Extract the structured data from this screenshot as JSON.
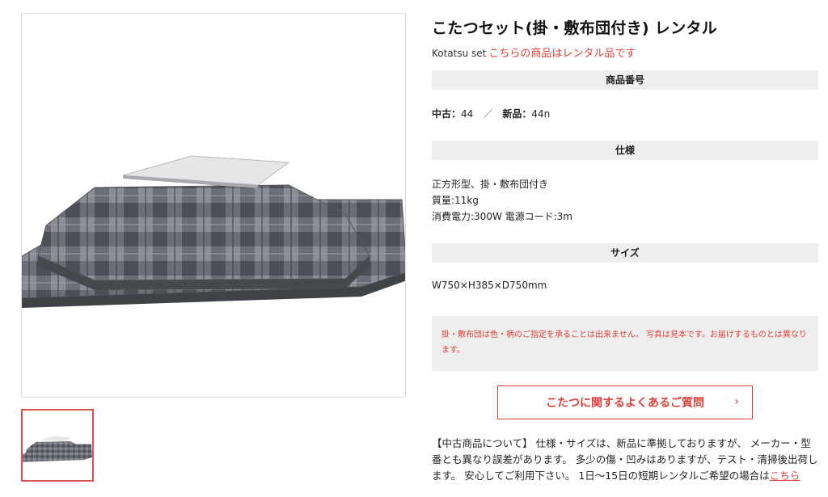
{
  "product": {
    "title": "こたつセット(掛・敷布団付き) レンタル",
    "subtitle_en": "Kotatsu set",
    "subtitle_note": "こちらの商品はレンタル品です"
  },
  "sections": {
    "code_header": "商品番号",
    "spec_header": "仕様",
    "size_header": "サイズ"
  },
  "codes": {
    "used_label": "中古：",
    "used_value": "44",
    "separator": "／",
    "new_label": "新品：",
    "new_value": "44n"
  },
  "spec": {
    "line1": "正方形型、掛・敷布団付き",
    "line2": "質量:11kg",
    "line3": "消費電力:300W 電源コード:3m"
  },
  "size": {
    "value": "W750×H385×D750mm"
  },
  "notice": {
    "text": "掛・敷布団は色・柄のご指定を承ることは出来ません。 写真は見本です。お届けするものとは異なります。"
  },
  "faq_button": {
    "label": "こたつに関するよくあるご質問",
    "chevron": "›"
  },
  "usage": {
    "text": "【中古商品について】 仕様・サイズは、新品に準拠しておりますが、 メーカー・型番とも異なり誤差があります。 多少の傷・凹みはありますが、テスト・清掃後出荷します。 安心してご利用下さい。 1日〜15日の短期レンタルご希望の場合は",
    "link": "こちら"
  },
  "images": {
    "main_icon": "kotatsu-photo",
    "thumb_icon": "kotatsu-thumbnail"
  },
  "colors": {
    "accent": "#e0413b",
    "section_bg": "#eeeeee"
  }
}
